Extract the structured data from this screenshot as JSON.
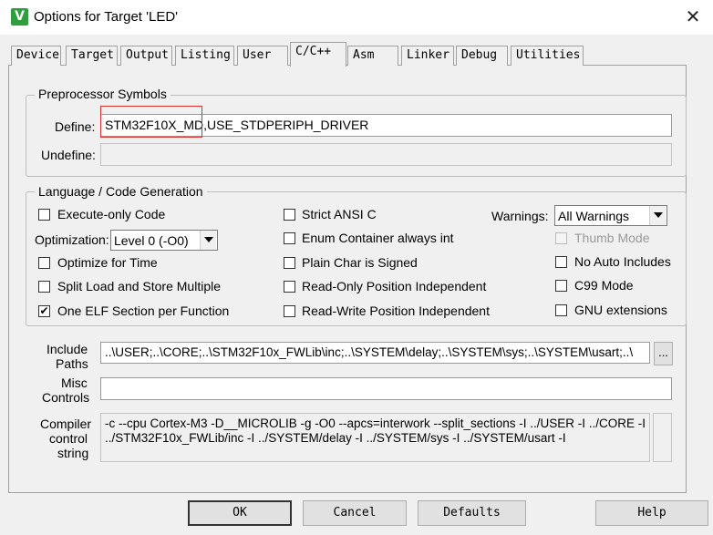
{
  "window": {
    "title": "Options for Target 'LED'",
    "app_icon_glyph": "V",
    "close_glyph": "✕"
  },
  "tabs": [
    "Device",
    "Target",
    "Output",
    "Listing",
    "User",
    "C/C++",
    "Asm",
    "Linker",
    "Debug",
    "Utilities"
  ],
  "active_tab": "C/C++",
  "preprocessor": {
    "legend": "Preprocessor Symbols",
    "define_label": "Define:",
    "define_value": "STM32F10X_MD,USE_STDPERIPH_DRIVER",
    "undefine_label": "Undefine:",
    "undefine_value": ""
  },
  "codegen": {
    "legend": "Language / Code Generation",
    "execute_only": {
      "label": "Execute-only Code",
      "checked": false
    },
    "optimization_label": "Optimization:",
    "optimization_value": "Level 0 (-O0)",
    "optimize_time": {
      "label": "Optimize for Time",
      "checked": false
    },
    "split_load": {
      "label": "Split Load and Store Multiple",
      "checked": false
    },
    "one_elf": {
      "label": "One ELF Section per Function",
      "checked": true
    },
    "strict_ansi": {
      "label": "Strict ANSI C",
      "checked": false
    },
    "enum_container": {
      "label": "Enum Container always int",
      "checked": false
    },
    "plain_char": {
      "label": "Plain Char is Signed",
      "checked": false
    },
    "ro_pi": {
      "label": "Read-Only Position Independent",
      "checked": false
    },
    "rw_pi": {
      "label": "Read-Write Position Independent",
      "checked": false
    },
    "warnings_label": "Warnings:",
    "warnings_value": "All Warnings",
    "thumb_mode": {
      "label": "Thumb Mode",
      "checked": false,
      "disabled": true
    },
    "no_auto_includes": {
      "label": "No Auto Includes",
      "checked": false
    },
    "c99_mode": {
      "label": "C99 Mode",
      "checked": false
    },
    "gnu_ext": {
      "label": "GNU extensions",
      "checked": false
    }
  },
  "include_paths": {
    "label_line1": "Include",
    "label_line2": "Paths",
    "value": "..\\USER;..\\CORE;..\\STM32F10x_FWLib\\inc;..\\SYSTEM\\delay;..\\SYSTEM\\sys;..\\SYSTEM\\usart;..\\",
    "browse_label": "..."
  },
  "misc_controls": {
    "label_line1": "Misc",
    "label_line2": "Controls",
    "value": ""
  },
  "compiler_string": {
    "label_line1": "Compiler",
    "label_line2": "control",
    "label_line3": "string",
    "line1": "-c --cpu Cortex-M3 -D__MICROLIB -g -O0 --apcs=interwork --split_sections -I ../USER -I ../CORE -I",
    "line2": "../STM32F10x_FWLib/inc -I ../SYSTEM/delay -I ../SYSTEM/sys -I ../SYSTEM/usart -I"
  },
  "buttons": {
    "ok": "OK",
    "cancel": "Cancel",
    "defaults": "Defaults",
    "help": "Help"
  },
  "colors": {
    "highlight_box": "#d9322d",
    "app_icon": "#2e9e3e"
  }
}
